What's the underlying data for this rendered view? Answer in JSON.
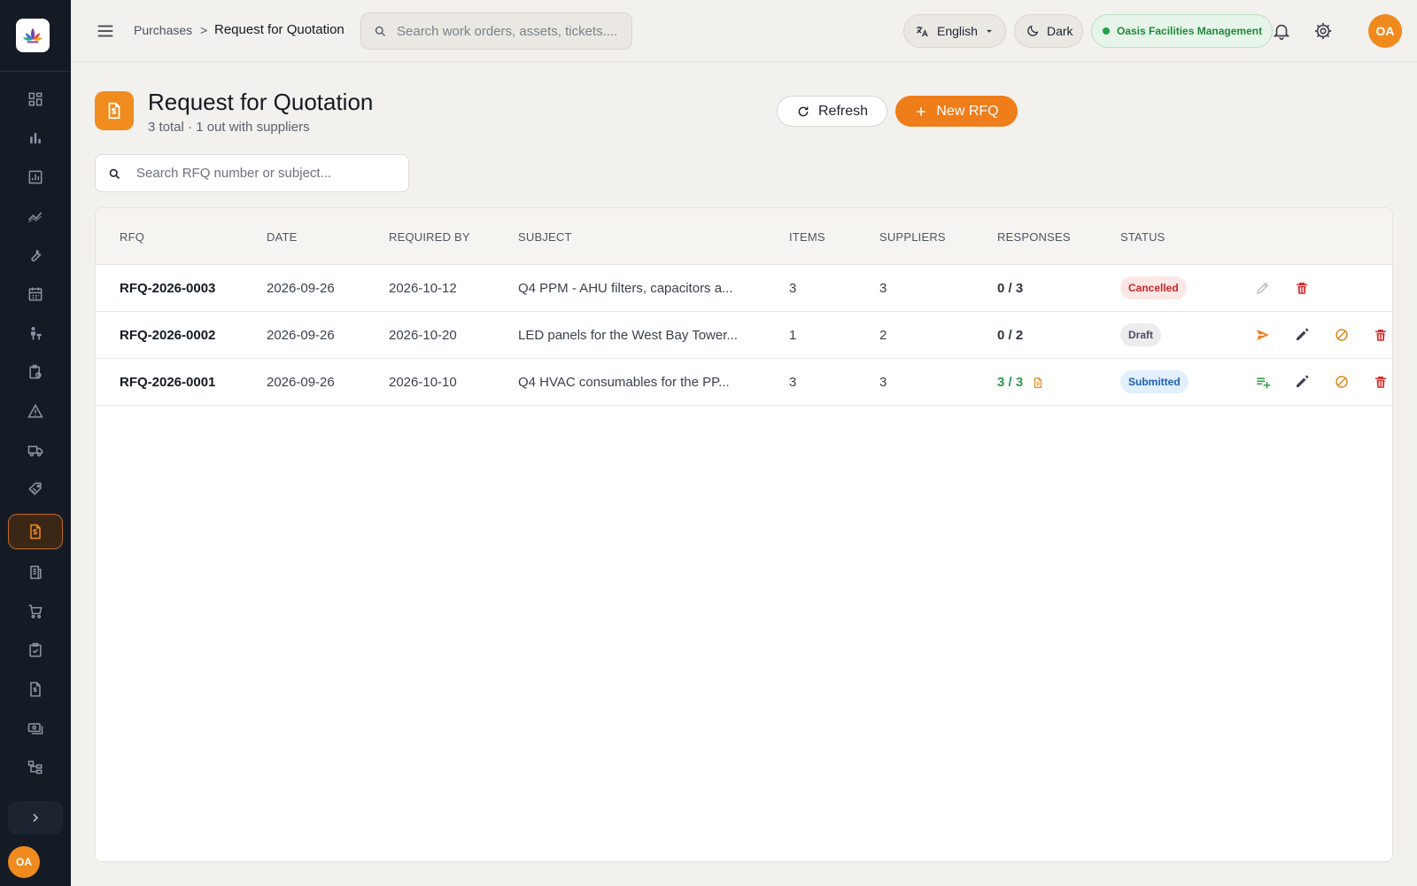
{
  "sidebar": {
    "items": [
      {
        "icon": "dashboard-icon"
      },
      {
        "icon": "bar-chart-icon"
      },
      {
        "icon": "analytics-icon"
      },
      {
        "icon": "trend-icon"
      },
      {
        "icon": "wrench-icon"
      },
      {
        "icon": "calendar-icon"
      },
      {
        "icon": "technician-icon"
      },
      {
        "icon": "clipboard-icon"
      },
      {
        "icon": "warning-icon"
      },
      {
        "icon": "truck-icon"
      },
      {
        "icon": "tag-icon"
      },
      {
        "icon": "rfq-document-icon",
        "active": true
      },
      {
        "icon": "receipt-icon"
      },
      {
        "icon": "cart-icon"
      },
      {
        "icon": "checklist-icon"
      },
      {
        "icon": "invoice-icon"
      },
      {
        "icon": "payments-icon"
      },
      {
        "icon": "hierarchy-icon"
      }
    ],
    "user_initials": "OA"
  },
  "topbar": {
    "breadcrumb_parent": "Purchases",
    "breadcrumb_separator": ">",
    "breadcrumb_current": "Request for Quotation",
    "search_placeholder": "Search work orders, assets, tickets....",
    "language": "English",
    "theme_label": "Dark",
    "organization": "Oasis Facilities Management",
    "user_initials": "OA"
  },
  "page": {
    "title": "Request for Quotation",
    "subtitle": "3 total · 1 out with suppliers",
    "refresh_label": "Refresh",
    "new_label": "New RFQ",
    "search_placeholder": "Search RFQ number or subject..."
  },
  "table": {
    "columns": [
      "RFQ",
      "DATE",
      "REQUIRED BY",
      "SUBJECT",
      "ITEMS",
      "SUPPLIERS",
      "RESPONSES",
      "STATUS"
    ],
    "rows": [
      {
        "rfq": "RFQ-2026-0003",
        "date": "2026-09-26",
        "required_by": "2026-10-12",
        "subject": "Q4 PPM - AHU filters, capacitors a...",
        "items": "3",
        "suppliers": "3",
        "responses": "0 / 3",
        "status": "Cancelled"
      },
      {
        "rfq": "RFQ-2026-0002",
        "date": "2026-09-26",
        "required_by": "2026-10-20",
        "subject": "LED panels for the West Bay Tower...",
        "items": "1",
        "suppliers": "2",
        "responses": "0 / 2",
        "status": "Draft"
      },
      {
        "rfq": "RFQ-2026-0001",
        "date": "2026-09-26",
        "required_by": "2026-10-10",
        "subject": "Q4 HVAC consumables for the PP...",
        "items": "3",
        "suppliers": "3",
        "responses": "3 / 3",
        "status": "Submitted"
      }
    ]
  },
  "colors": {
    "accent": "#ef7d1a",
    "sidebar": "#141b24",
    "success": "#2b9a4c",
    "danger": "#c62828"
  }
}
